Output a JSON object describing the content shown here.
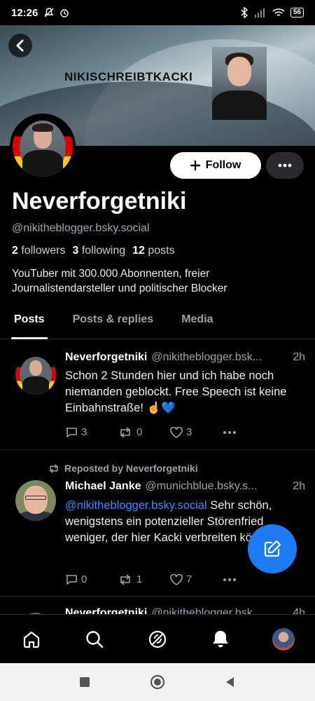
{
  "status_bar": {
    "time": "12:26",
    "battery": "56"
  },
  "banner": {
    "title": "NIKISCHREIBTKACKI"
  },
  "profile": {
    "display_name": "Neverforgetniki",
    "handle": "@nikitheblogger.bsky.social",
    "followers_count": "2",
    "followers_label": "followers",
    "following_count": "3",
    "following_label": "following",
    "posts_count": "12",
    "posts_label": "posts",
    "bio": "YouTuber mit 300.000 Abonnenten, freier Journalistendarsteller und politischer Blocker",
    "follow_label": "Follow"
  },
  "tabs": [
    {
      "label": "Posts",
      "active": true
    },
    {
      "label": "Posts & replies",
      "active": false
    },
    {
      "label": "Media",
      "active": false
    }
  ],
  "posts": [
    {
      "author": "Neverforgetniki",
      "handle": "@nikitheblogger.bsk...",
      "time": "2h",
      "text": "Schon 2 Stunden hier und ich habe noch niemanden geblockt. Free Speech ist keine Einbahnstraße! ☝️💙",
      "replies": "3",
      "reposts": "0",
      "likes": "3"
    },
    {
      "repost_label": "Reposted by Neverforgetniki",
      "author": "Michael Janke",
      "handle": "@munichblue.bsky.s...",
      "time": "2h",
      "mention": "@nikitheblogger.bsky.social",
      "text": " Sehr schön, wenigstens ein potenzieller Störenfried weniger, der hier Kacki verbreiten könnte.",
      "replies": "0",
      "reposts": "1",
      "likes": "7"
    },
    {
      "author": "Neverforgetniki",
      "handle": "@nikitheblogger.bsk...",
      "time": "4h"
    }
  ],
  "icons": {
    "back": "chevron-left-icon",
    "more": "ellipsis-icon",
    "compose": "pencil-square-icon",
    "nav": [
      "home-icon",
      "search-icon",
      "feeds-icon",
      "notifications-icon",
      "profile-avatar"
    ]
  },
  "colors": {
    "accent": "#1c7bf5",
    "mention": "#3b8bff",
    "background": "#000000"
  }
}
